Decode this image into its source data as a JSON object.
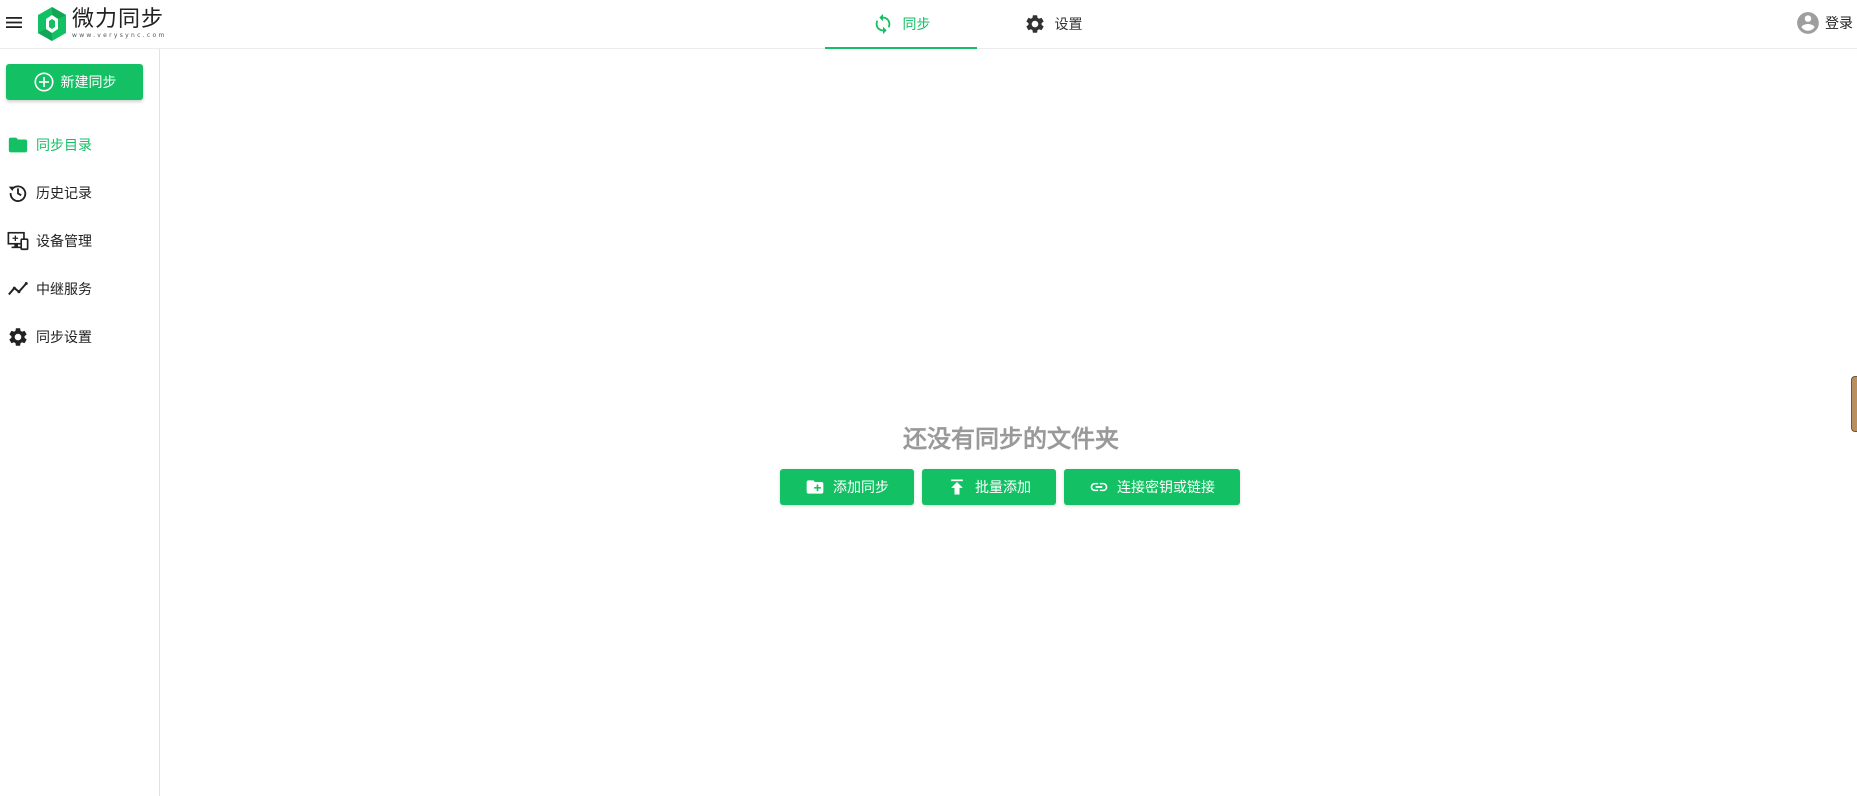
{
  "app": {
    "name": "微力同步",
    "url_text": "www.verysync.com"
  },
  "header": {
    "tabs": [
      {
        "label": "同步",
        "icon": "sync-icon",
        "active": true
      },
      {
        "label": "设置",
        "icon": "gear-icon",
        "active": false
      }
    ],
    "login_label": "登录"
  },
  "sidebar": {
    "new_sync_label": "新建同步",
    "items": [
      {
        "label": "同步目录",
        "icon": "folder-icon",
        "active": true
      },
      {
        "label": "历史记录",
        "icon": "history-icon",
        "active": false
      },
      {
        "label": "设备管理",
        "icon": "devices-icon",
        "active": false
      },
      {
        "label": "中继服务",
        "icon": "trend-icon",
        "active": false
      },
      {
        "label": "同步设置",
        "icon": "gear-icon",
        "active": false
      }
    ]
  },
  "main": {
    "empty_title": "还没有同步的文件夹",
    "actions": [
      {
        "label": "添加同步",
        "icon": "folder-add-icon"
      },
      {
        "label": "批量添加",
        "icon": "upload-icon"
      },
      {
        "label": "连接密钥或链接",
        "icon": "link-icon"
      }
    ]
  },
  "colors": {
    "accent": "#13c064",
    "muted_text": "#999999"
  }
}
